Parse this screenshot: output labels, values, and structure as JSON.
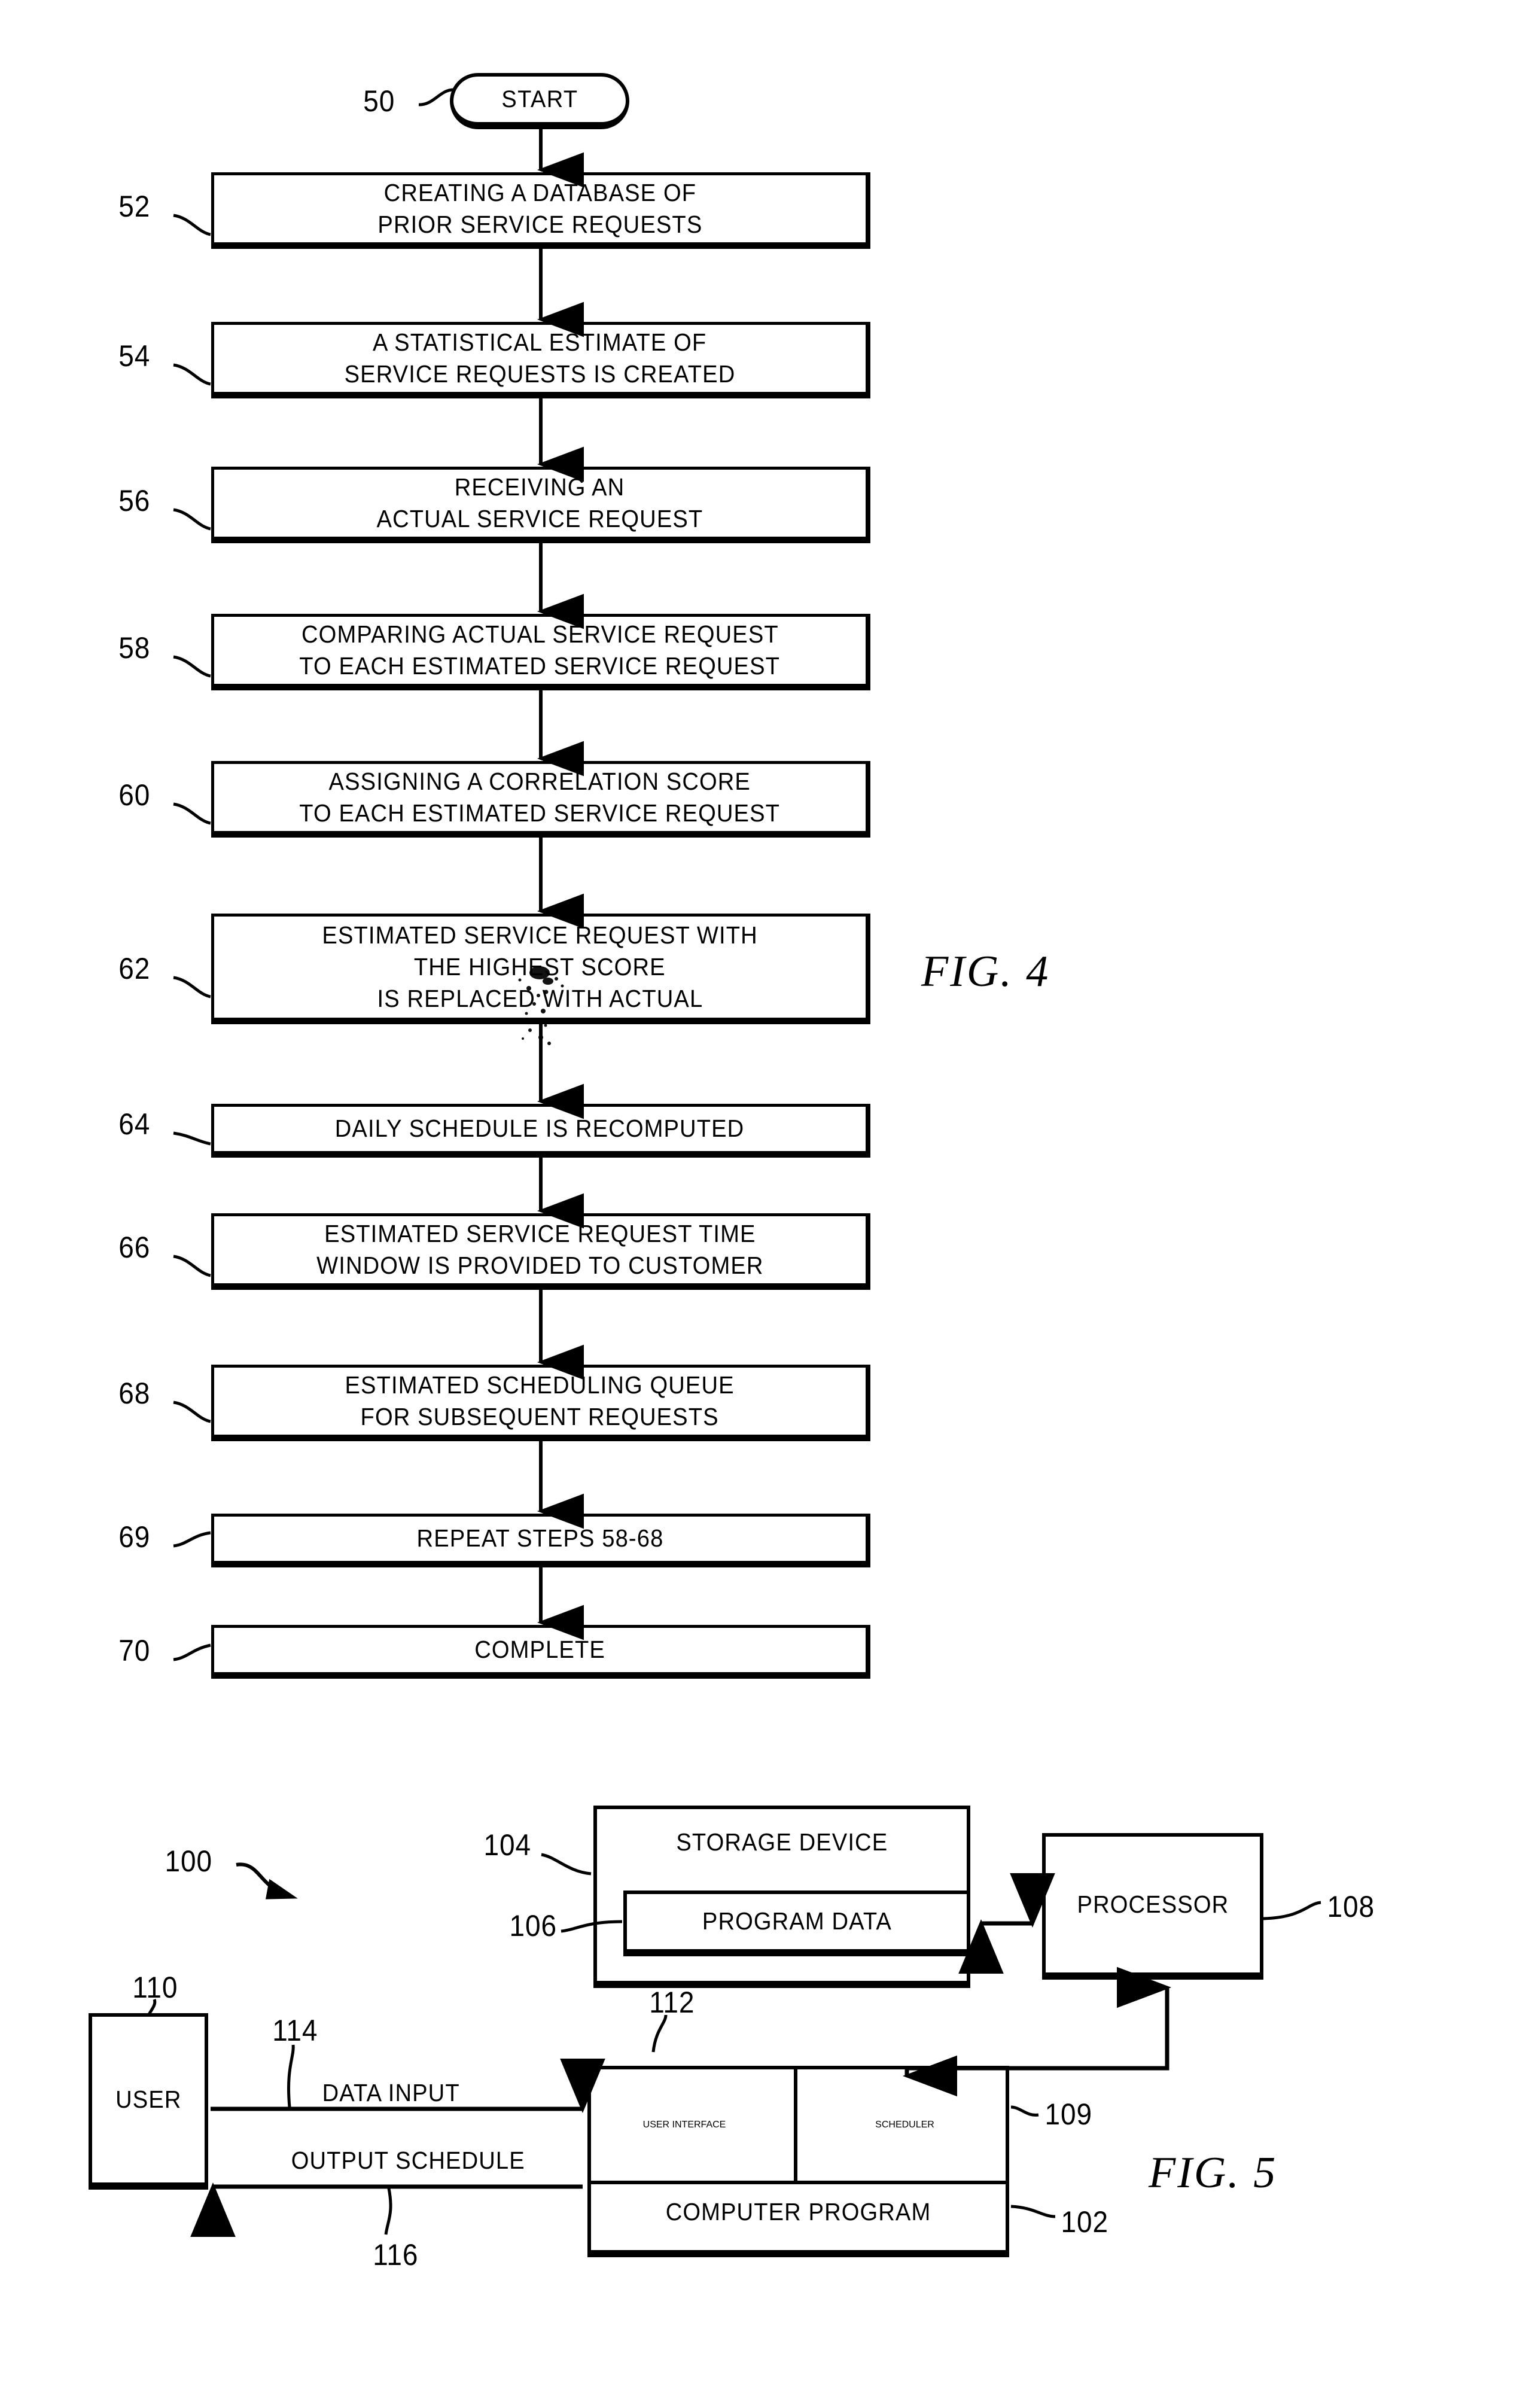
{
  "figures": [
    {
      "caption": "FIG.  4",
      "type": "flowchart",
      "start_node": {
        "ref": "50",
        "label": "START"
      },
      "steps": [
        {
          "ref": "52",
          "lines": [
            "CREATING A DATABASE OF",
            "PRIOR SERVICE REQUESTS"
          ]
        },
        {
          "ref": "54",
          "lines": [
            "A STATISTICAL ESTIMATE OF",
            "SERVICE REQUESTS IS CREATED"
          ]
        },
        {
          "ref": "56",
          "lines": [
            "RECEIVING AN",
            "ACTUAL SERVICE REQUEST"
          ]
        },
        {
          "ref": "58",
          "lines": [
            "COMPARING ACTUAL SERVICE REQUEST",
            "TO EACH ESTIMATED SERVICE REQUEST"
          ]
        },
        {
          "ref": "60",
          "lines": [
            "ASSIGNING A CORRELATION SCORE",
            "TO EACH ESTIMATED SERVICE REQUEST"
          ]
        },
        {
          "ref": "62",
          "lines": [
            "ESTIMATED SERVICE REQUEST WITH",
            "THE HIGHEST SCORE",
            "IS REPLACED WITH ACTUAL"
          ]
        },
        {
          "ref": "64",
          "lines": [
            "DAILY SCHEDULE IS RECOMPUTED"
          ]
        },
        {
          "ref": "66",
          "lines": [
            "ESTIMATED SERVICE REQUEST TIME",
            "WINDOW IS PROVIDED TO CUSTOMER"
          ]
        },
        {
          "ref": "68",
          "lines": [
            "ESTIMATED SCHEDULING QUEUE",
            "FOR SUBSEQUENT REQUESTS"
          ]
        },
        {
          "ref": "69",
          "lines": [
            "REPEAT STEPS 58-68"
          ]
        },
        {
          "ref": "70",
          "lines": [
            "COMPLETE"
          ]
        }
      ]
    },
    {
      "caption": "FIG.  5",
      "type": "block-diagram",
      "system_ref": "100",
      "blocks": [
        {
          "ref": "104",
          "label": "STORAGE DEVICE"
        },
        {
          "ref": "106",
          "label": "PROGRAM DATA"
        },
        {
          "ref": "108",
          "label": "PROCESSOR"
        },
        {
          "ref": "110",
          "label": "USER"
        },
        {
          "ref": "112",
          "lines": [
            "USER",
            "INTERFACE"
          ]
        },
        {
          "ref": "109",
          "label": "SCHEDULER"
        },
        {
          "ref": "102",
          "label": "COMPUTER PROGRAM"
        }
      ],
      "connections": [
        {
          "ref": "114",
          "label": "DATA INPUT"
        },
        {
          "ref": "116",
          "label": "OUTPUT SCHEDULE"
        }
      ]
    }
  ]
}
